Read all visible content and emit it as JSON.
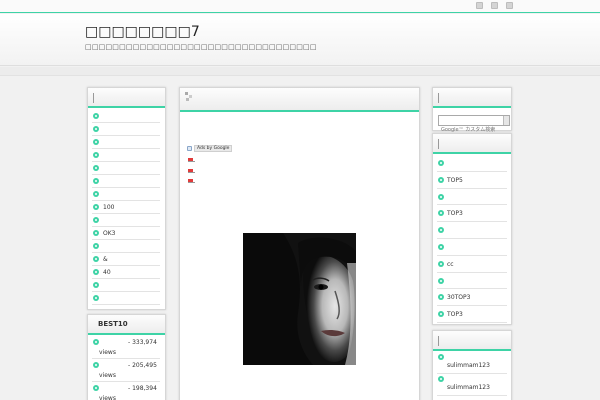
{
  "header": {
    "title": "□□□□□□□□7",
    "description": "□□□□□□□□□□□□□□□□□□□□□□□□□□□□□□□□□□"
  },
  "top_icons": [
    "●",
    "●",
    "●"
  ],
  "left": {
    "category_items": [
      "",
      "",
      "",
      "",
      "",
      "",
      "",
      "100",
      "",
      "OK3",
      "",
      "&",
      "40",
      "",
      ""
    ],
    "ranking": {
      "title": "BEST10",
      "items": [
        {
          "views": "- 333,974",
          "unit": "views"
        },
        {
          "views": "- 205,495",
          "unit": "views"
        },
        {
          "views": "- 198,394",
          "unit": "views"
        }
      ]
    }
  },
  "main": {
    "ads_label": "Ads by Google"
  },
  "right": {
    "search": {
      "placeholder": "Google™ カスタム検索"
    },
    "list_items": [
      "",
      "TOP5",
      "",
      "TOP3",
      "",
      "",
      "cc",
      "",
      "30TOP3",
      "TOP3"
    ],
    "users": [
      "sulimmam123",
      "sulimmam123"
    ]
  },
  "colors": {
    "accent": "#3ed3a6"
  }
}
